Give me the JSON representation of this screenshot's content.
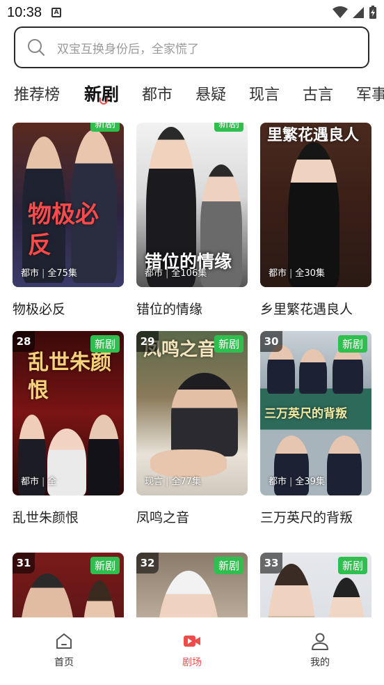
{
  "status": {
    "time": "10:38",
    "notif": "A"
  },
  "search": {
    "placeholder": "双宝互换身份后，全家慌了"
  },
  "tabs": [
    "推荐榜",
    "新剧",
    "都市",
    "悬疑",
    "现言",
    "古言",
    "军事"
  ],
  "dramas": [
    {
      "title": "物极必反",
      "genre": "都市",
      "episodes": "全75集",
      "badge": "新剧",
      "poster_text": "物极必反"
    },
    {
      "title": "错位的情缘",
      "genre": "都市",
      "episodes": "全106集",
      "badge": "新剧",
      "poster_text": "错位的情缘"
    },
    {
      "title": "乡里繁花遇良人",
      "genre": "都市",
      "episodes": "全30集",
      "badge": "新剧",
      "poster_text": "里繁花遇良人"
    },
    {
      "rank": "28",
      "title": "乱世朱颜恨",
      "genre": "都市",
      "episodes": "全",
      "badge": "新剧",
      "poster_text": "乱世朱颜恨"
    },
    {
      "rank": "29",
      "title": "凤鸣之音",
      "genre": "现言",
      "episodes": "全77集",
      "badge": "新剧",
      "poster_text": "凤鸣之音"
    },
    {
      "rank": "30",
      "title": "三万英尺的背叛",
      "genre": "都市",
      "episodes": "全39集",
      "badge": "新剧",
      "poster_text": "三万英尺的背叛"
    },
    {
      "rank": "31",
      "badge": "新剧"
    },
    {
      "rank": "32",
      "badge": "新剧"
    },
    {
      "rank": "33",
      "badge": "新剧"
    }
  ],
  "nav": [
    {
      "label": "首页",
      "icon": "home-icon"
    },
    {
      "label": "剧场",
      "icon": "video-icon"
    },
    {
      "label": "我的",
      "icon": "user-icon"
    }
  ],
  "colors": {
    "accent": "#f04c4c",
    "badge": "#2fbf4f"
  }
}
